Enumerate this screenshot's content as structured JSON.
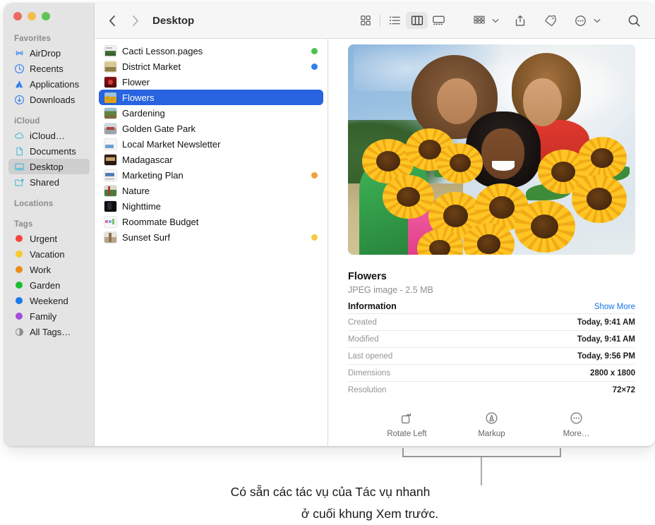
{
  "window": {
    "title": "Desktop",
    "traffic_lights": [
      {
        "name": "close",
        "color": "#ec6a5f"
      },
      {
        "name": "minimize",
        "color": "#f4bd4f"
      },
      {
        "name": "zoom",
        "color": "#61c555"
      }
    ],
    "nav": {
      "back": "back-icon",
      "forward": "forward-icon"
    }
  },
  "toolbar": {
    "view_buttons": [
      {
        "name": "icon-view",
        "active": false
      },
      {
        "name": "list-view",
        "active": false
      },
      {
        "name": "column-view",
        "active": true
      },
      {
        "name": "gallery-view",
        "active": false
      }
    ],
    "group_label": "group-by-icon",
    "share_label": "share-icon",
    "tags_label": "tag-icon",
    "more_label": "more-actions-icon",
    "search_label": "search-icon"
  },
  "sidebar": {
    "sections": [
      {
        "header": "Favorites",
        "items": [
          {
            "label": "AirDrop",
            "icon": "airdrop-icon",
            "selected": false
          },
          {
            "label": "Recents",
            "icon": "clock-icon",
            "selected": false
          },
          {
            "label": "Applications",
            "icon": "applications-icon",
            "selected": false
          },
          {
            "label": "Downloads",
            "icon": "downloads-icon",
            "selected": false
          }
        ]
      },
      {
        "header": "iCloud",
        "items": [
          {
            "label": "iCloud…",
            "icon": "cloud-icon",
            "selected": false
          },
          {
            "label": "Documents",
            "icon": "document-icon",
            "selected": false
          },
          {
            "label": "Desktop",
            "icon": "desktop-icon",
            "selected": true
          },
          {
            "label": "Shared",
            "icon": "shared-folder-icon",
            "selected": false
          }
        ]
      },
      {
        "header": "Locations",
        "items": []
      },
      {
        "header": "Tags",
        "items": [
          {
            "label": "Urgent",
            "icon": "tag-dot-icon",
            "color": "#f6453c",
            "selected": false
          },
          {
            "label": "Vacation",
            "icon": "tag-dot-icon",
            "color": "#f7c92e",
            "selected": false
          },
          {
            "label": "Work",
            "icon": "tag-dot-icon",
            "color": "#f08c17",
            "selected": false
          },
          {
            "label": "Garden",
            "icon": "tag-dot-icon",
            "color": "#1dbd36",
            "selected": false
          },
          {
            "label": "Weekend",
            "icon": "tag-dot-icon",
            "color": "#177bef",
            "selected": false
          },
          {
            "label": "Family",
            "icon": "tag-dot-icon",
            "color": "#a34ddd",
            "selected": false
          },
          {
            "label": "All Tags…",
            "icon": "all-tags-icon",
            "color": "",
            "selected": false
          }
        ]
      }
    ]
  },
  "file_list": [
    {
      "name": "Cacti Lesson.pages",
      "icon": "pages-document-icon",
      "tag_color": "#4cc14a"
    },
    {
      "name": "District Market",
      "icon": "image-file-icon",
      "tag_color": "#2f7ff0"
    },
    {
      "name": "Flower",
      "icon": "image-file-icon",
      "tag_color": ""
    },
    {
      "name": "Flowers",
      "icon": "image-file-icon",
      "tag_color": "",
      "selected": true
    },
    {
      "name": "Gardening",
      "icon": "image-file-icon",
      "tag_color": ""
    },
    {
      "name": "Golden Gate Park",
      "icon": "image-file-icon",
      "tag_color": ""
    },
    {
      "name": "Local Market Newsletter",
      "icon": "pages-document-icon",
      "tag_color": ""
    },
    {
      "name": "Madagascar",
      "icon": "image-file-icon",
      "tag_color": ""
    },
    {
      "name": "Marketing Plan",
      "icon": "keynote-document-icon",
      "tag_color": "#f0a33a"
    },
    {
      "name": "Nature",
      "icon": "image-file-icon",
      "tag_color": ""
    },
    {
      "name": "Nighttime",
      "icon": "image-file-icon",
      "tag_color": ""
    },
    {
      "name": "Roommate Budget",
      "icon": "numbers-document-icon",
      "tag_color": ""
    },
    {
      "name": "Sunset Surf",
      "icon": "image-file-icon",
      "tag_color": "#f6c councils"
    }
  ],
  "preview": {
    "title": "Flowers",
    "subtitle": "JPEG image - 2.5 MB",
    "info_heading": "Information",
    "show_more": "Show More",
    "info_rows": [
      {
        "key": "Created",
        "value": "Today, 9:41 AM"
      },
      {
        "key": "Modified",
        "value": "Today, 9:41 AM"
      },
      {
        "key": "Last opened",
        "value": "Today, 9:56 PM"
      },
      {
        "key": "Dimensions",
        "value": "2800 x 1800"
      },
      {
        "key": "Resolution",
        "value": "72×72"
      }
    ],
    "quick_actions": [
      {
        "label": "Rotate Left",
        "icon": "rotate-left-icon"
      },
      {
        "label": "Markup",
        "icon": "markup-icon"
      },
      {
        "label": "More…",
        "icon": "more-circle-icon"
      }
    ]
  },
  "callout": {
    "line1": "Có sẵn các tác vụ của Tác vụ nhanh",
    "line2": "ở cuối khung Xem trước."
  },
  "colors": {
    "selection_blue": "#2864e0",
    "link_blue": "#1673e6",
    "sidebar_bg": "#e4e4e4",
    "toolbar_bg": "#f6f6f6"
  }
}
